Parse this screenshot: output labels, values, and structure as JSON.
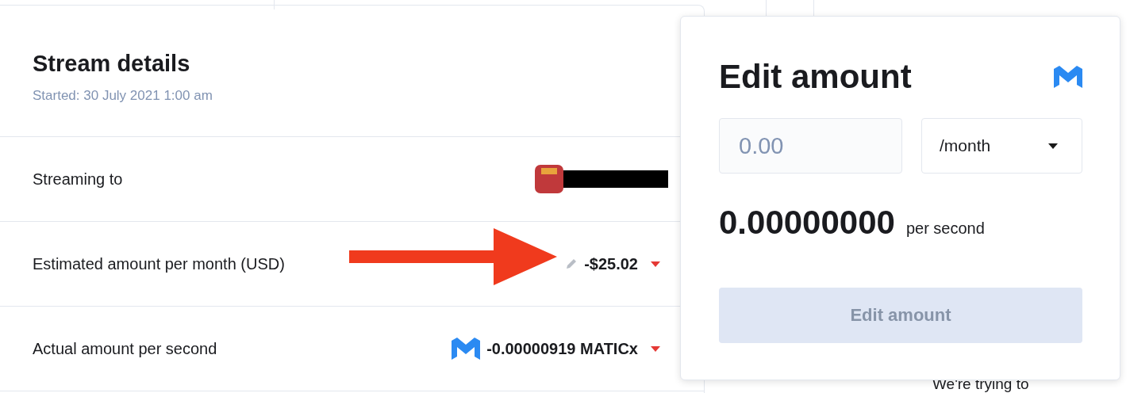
{
  "stream_details": {
    "title": "Stream details",
    "started": "Started: 30 July 2021 1:00 am",
    "rows": [
      {
        "kind": "recipient",
        "label": "Streaming to"
      },
      {
        "kind": "fiat",
        "label": "Estimated amount per month (USD)",
        "value": "-$25.02"
      },
      {
        "kind": "token",
        "label": "Actual amount per second",
        "value": "-0.00000919 MATICx"
      }
    ]
  },
  "edit_amount": {
    "title": "Edit amount",
    "amount_field": {
      "placeholder": "0.00"
    },
    "period_select": {
      "value": "/month"
    },
    "rate": "0.00000000",
    "rate_unit": "per second",
    "button": {
      "label": "Edit amount",
      "disabled": true
    }
  },
  "background_text": "We're trying to"
}
